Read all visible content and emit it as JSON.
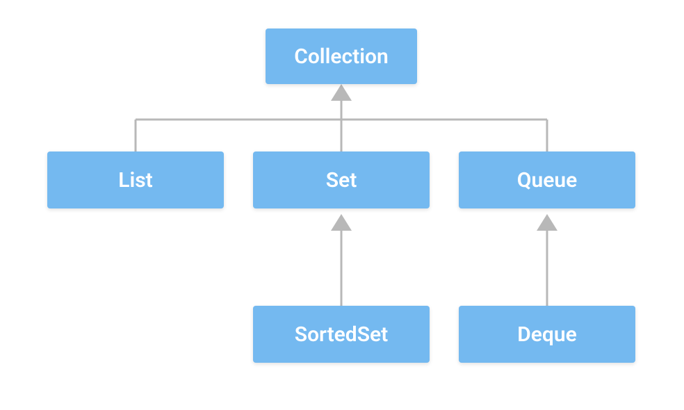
{
  "diagram": {
    "nodes": {
      "collection": {
        "label": "Collection"
      },
      "list": {
        "label": "List"
      },
      "set": {
        "label": "Set"
      },
      "queue": {
        "label": "Queue"
      },
      "sortedset": {
        "label": "SortedSet"
      },
      "deque": {
        "label": "Deque"
      }
    },
    "edges": [
      {
        "from": "list",
        "to": "collection"
      },
      {
        "from": "set",
        "to": "collection"
      },
      {
        "from": "queue",
        "to": "collection"
      },
      {
        "from": "sortedset",
        "to": "set"
      },
      {
        "from": "deque",
        "to": "queue"
      }
    ],
    "colors": {
      "node_bg": "#74b9f0",
      "node_text": "#ffffff",
      "edge": "#b8b8b8"
    }
  }
}
